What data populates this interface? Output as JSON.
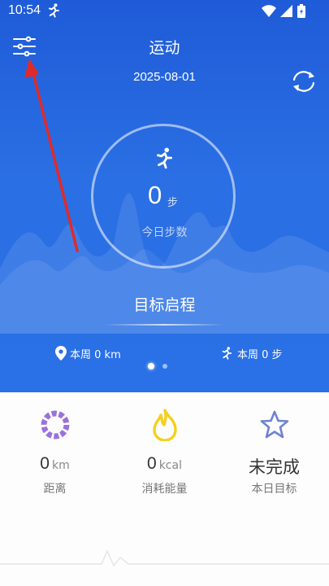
{
  "status_bar": {
    "time": "10:54",
    "icons": [
      "running-icon",
      "wifi-icon",
      "signal-icon",
      "battery-icon"
    ]
  },
  "header": {
    "title": "运动",
    "date": "2025-08-01",
    "left_icon": "filter-sliders-icon",
    "right_icon": "sync-icon"
  },
  "progress": {
    "steps_value": "0",
    "steps_unit": "步",
    "label": "今日步数"
  },
  "goal": {
    "title": "目标启程"
  },
  "weekly": {
    "distance": "本周 0 km",
    "steps": "本周 0 步"
  },
  "pager": {
    "page_count": 2,
    "active_index": 0
  },
  "stats": [
    {
      "icon": "distance-ring-icon",
      "value": "0",
      "unit": "km",
      "label": "距离"
    },
    {
      "icon": "flame-icon",
      "value": "0",
      "unit": "kcal",
      "label": "消耗能量"
    },
    {
      "icon": "star-icon",
      "value": "未完成",
      "unit": "",
      "label": "本日目标"
    }
  ],
  "colors": {
    "primary_blue": "#2a6fe3",
    "purple": "#9b72d9",
    "yellow": "#f5cf1e",
    "star_blue": "#6e83cf",
    "arrow_red": "#e02a2a"
  }
}
